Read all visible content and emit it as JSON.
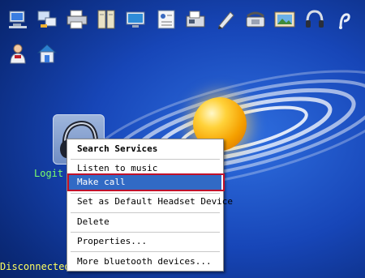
{
  "desktop": {
    "toolbar_icons": [
      "network-computer-icon",
      "network-share-icon",
      "printer-icon",
      "file-transfer-icon",
      "display-icon",
      "contact-card-icon",
      "fax-icon",
      "pen-icon",
      "phone-icon",
      "picture-icon",
      "headset-icon",
      "audio-icon",
      "user-icon",
      "home-network-icon"
    ]
  },
  "device": {
    "label": "Logit",
    "icon": "headset-icon",
    "status": "Disconnected"
  },
  "context_menu": {
    "items": [
      {
        "label": "Search Services",
        "bold": true
      },
      {
        "label": "Listen to music"
      },
      {
        "label": "Make call",
        "highlighted": true
      },
      {
        "label": "Set as Default Headset Device"
      },
      {
        "label": "Delete"
      },
      {
        "label": "Properties..."
      },
      {
        "label": "More bluetooth devices..."
      }
    ]
  },
  "colors": {
    "highlight": "#316ac5",
    "annotation_border": "#c0102a",
    "status_text": "#ffff60",
    "device_label": "#7cff6a"
  }
}
